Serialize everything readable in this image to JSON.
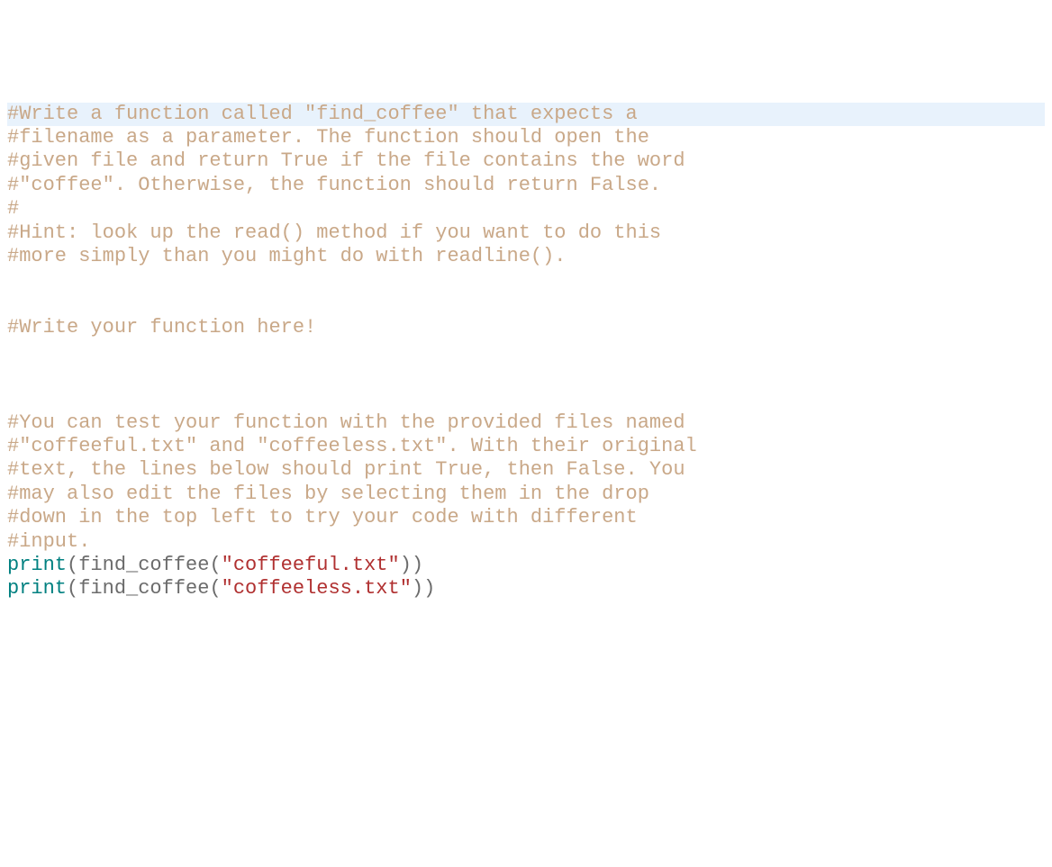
{
  "code": {
    "line1": "#Write a function called \"find_coffee\" that expects a",
    "line2": "#filename as a parameter. The function should open the",
    "line3": "#given file and return True if the file contains the word",
    "line4": "#\"coffee\". Otherwise, the function should return False.",
    "line5": "#",
    "line6": "#Hint: look up the read() method if you want to do this",
    "line7": "#more simply than you might do with readline().",
    "line8": "",
    "line9": "",
    "line10": "#Write your function here!",
    "line11": "",
    "line12": "",
    "line13": "",
    "line14": "#You can test your function with the provided files named",
    "line15": "#\"coffeeful.txt\" and \"coffeeless.txt\". With their original",
    "line16": "#text, the lines below should print True, then False. You",
    "line17": "#may also edit the files by selecting them in the drop",
    "line18": "#down in the top left to try your code with different",
    "line19": "#input.",
    "line20_keyword": "print",
    "line20_paren_open": "(",
    "line20_func": "find_coffee",
    "line20_paren2_open": "(",
    "line20_string": "\"coffeeful.txt\"",
    "line20_paren_close": "))",
    "line21_keyword": "print",
    "line21_paren_open": "(",
    "line21_func": "find_coffee",
    "line21_paren2_open": "(",
    "line21_string": "\"coffeeless.txt\"",
    "line21_paren_close": "))"
  }
}
